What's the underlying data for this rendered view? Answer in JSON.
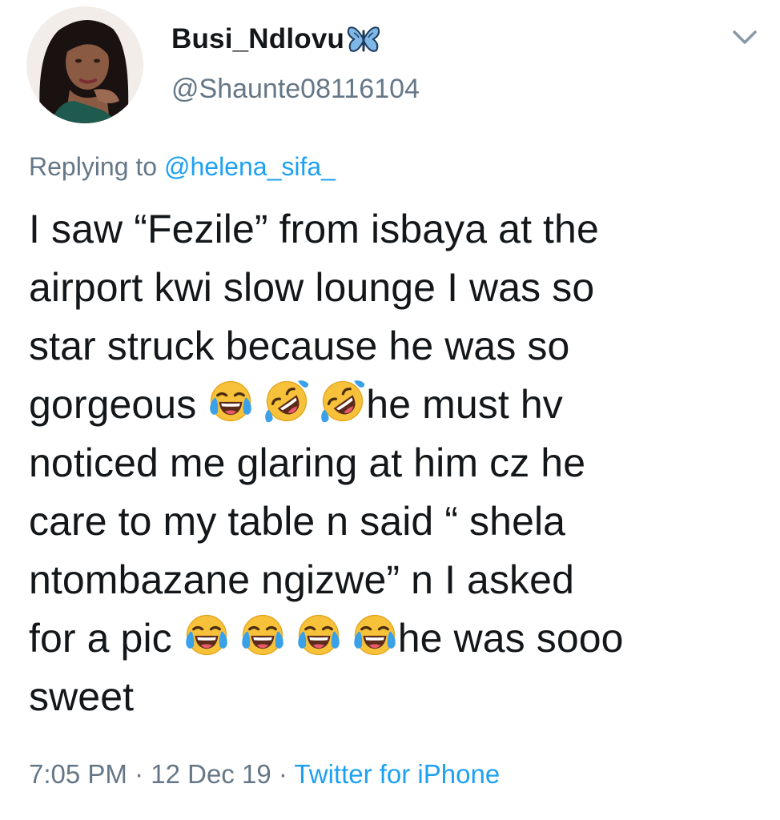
{
  "author": {
    "display_name": "Busi_Ndlovu",
    "handle": "@Shaunte08116104",
    "badge_icon": "butterfly-icon"
  },
  "reply": {
    "prefix": "Replying to ",
    "mention": "@helena_sifa_"
  },
  "body": {
    "line1": "I saw “Fezile” from isbaya at the",
    "line2": "airport kwi slow lounge I was so",
    "line3": "star struck because he was so",
    "line4_start": "gorgeous ",
    "line4_emojis": [
      "face-with-tears-of-joy",
      "rolling-on-the-floor-laughing",
      "rolling-on-the-floor-laughing"
    ],
    "line4_end": "he must hv",
    "line5": "noticed me glaring at him cz he",
    "line6": "care to my table n said “ shela",
    "line7": "ntombazane ngizwe” n I asked",
    "line8_start": "for a pic ",
    "line8_emojis": [
      "face-with-tears-of-joy",
      "face-with-tears-of-joy",
      "face-with-tears-of-joy",
      "face-with-tears-of-joy"
    ],
    "line8_end": "he was sooo",
    "line9": "sweet"
  },
  "meta": {
    "time": "7:05 PM",
    "sep1": " · ",
    "date": "12 Dec 19",
    "sep2": " · ",
    "source": "Twitter for iPhone"
  },
  "colors": {
    "text": "#14171a",
    "secondary": "#657786",
    "link": "#1da1f2",
    "background": "#ffffff"
  }
}
